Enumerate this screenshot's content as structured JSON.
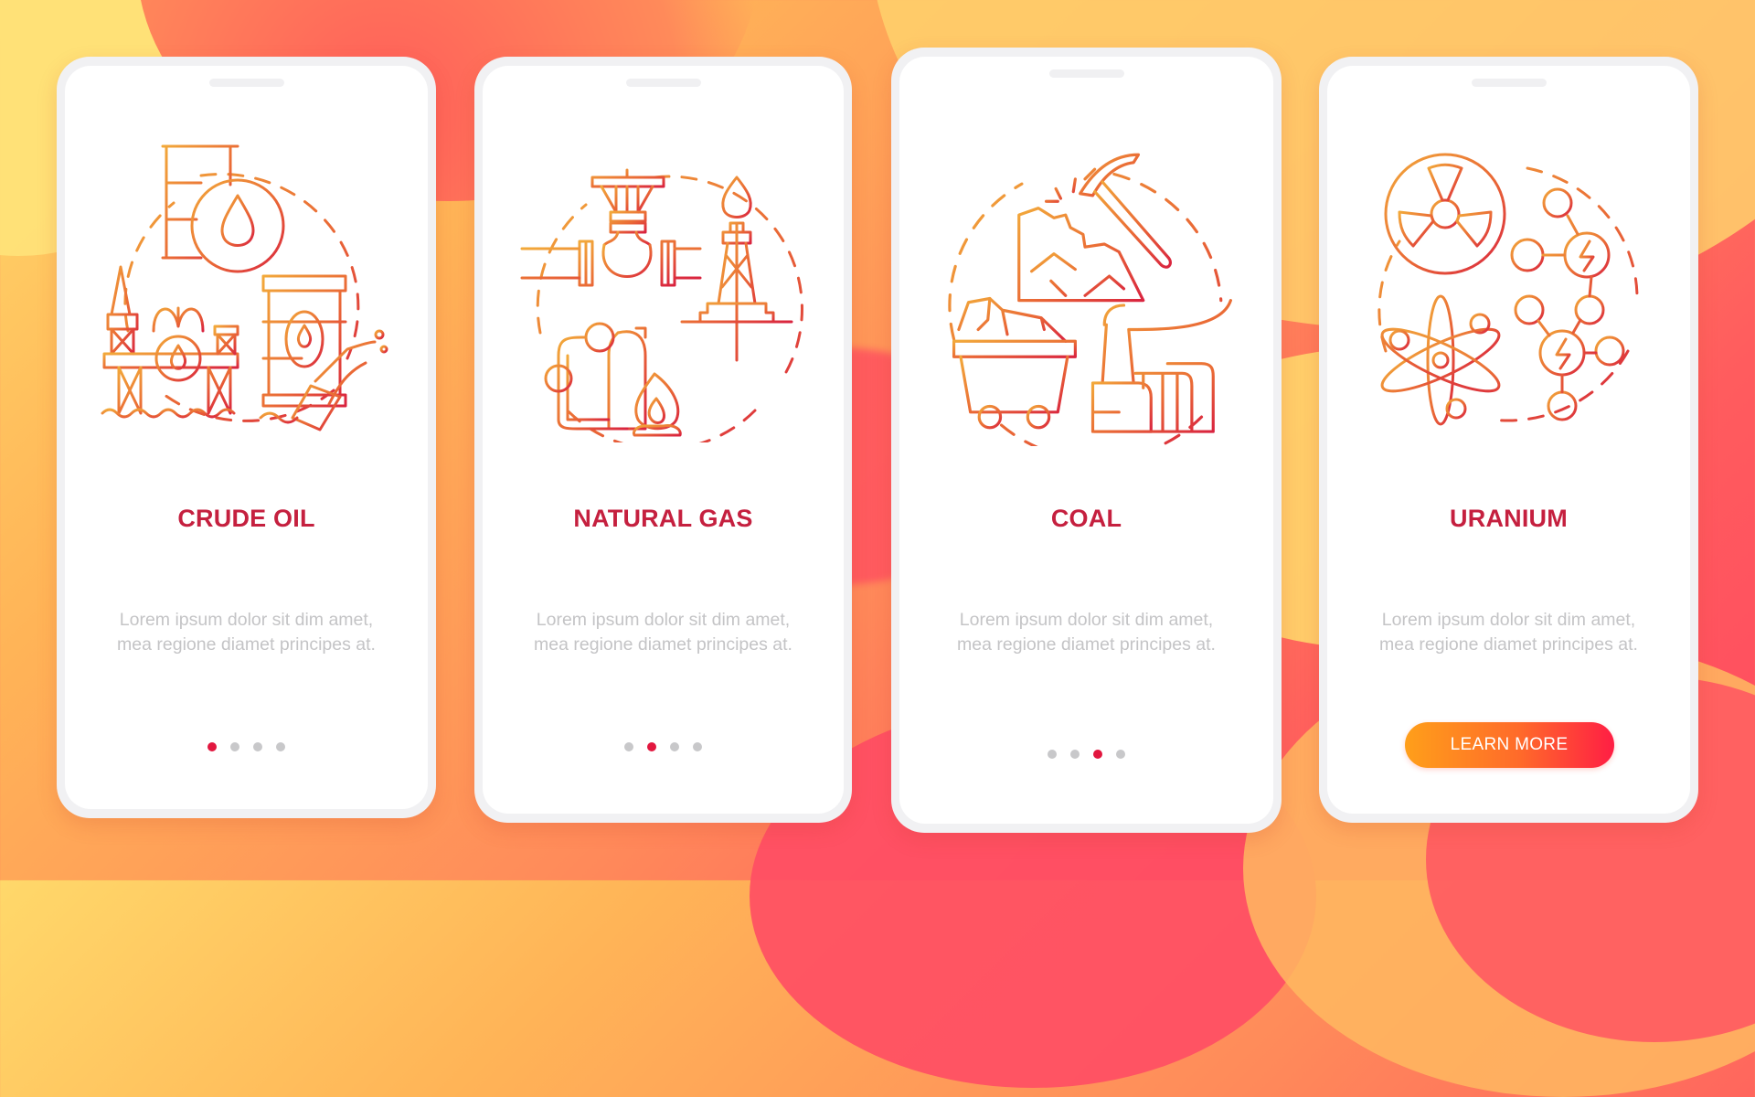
{
  "theme": {
    "title_color": "#c5203f",
    "body_color": "#c4c4c6",
    "dot_active": "#e2173f",
    "dot_inactive": "#c8c8ca",
    "icon_gradient": [
      "#f0a23a",
      "#e0303f"
    ],
    "button_gradient": [
      "#ff9f1a",
      "#ff1e44"
    ]
  },
  "screens": [
    {
      "title": "CRUDE OIL",
      "body": "Lorem ipsum dolor sit dim amet, mea regione diamet principes at.",
      "illustration": "crude-oil-icon",
      "page_indicator": {
        "current": 1,
        "total": 4
      }
    },
    {
      "title": "NATURAL GAS",
      "body": "Lorem ipsum dolor sit dim amet, mea regione diamet principes at.",
      "illustration": "natural-gas-icon",
      "page_indicator": {
        "current": 2,
        "total": 4
      }
    },
    {
      "title": "COAL",
      "body": "Lorem ipsum dolor sit dim amet, mea regione diamet principes at.",
      "illustration": "coal-icon",
      "page_indicator": {
        "current": 3,
        "total": 4
      }
    },
    {
      "title": "URANIUM",
      "body": "Lorem ipsum dolor sit dim amet, mea regione diamet principes at.",
      "illustration": "uranium-icon",
      "button_label": "LEARN MORE"
    }
  ]
}
